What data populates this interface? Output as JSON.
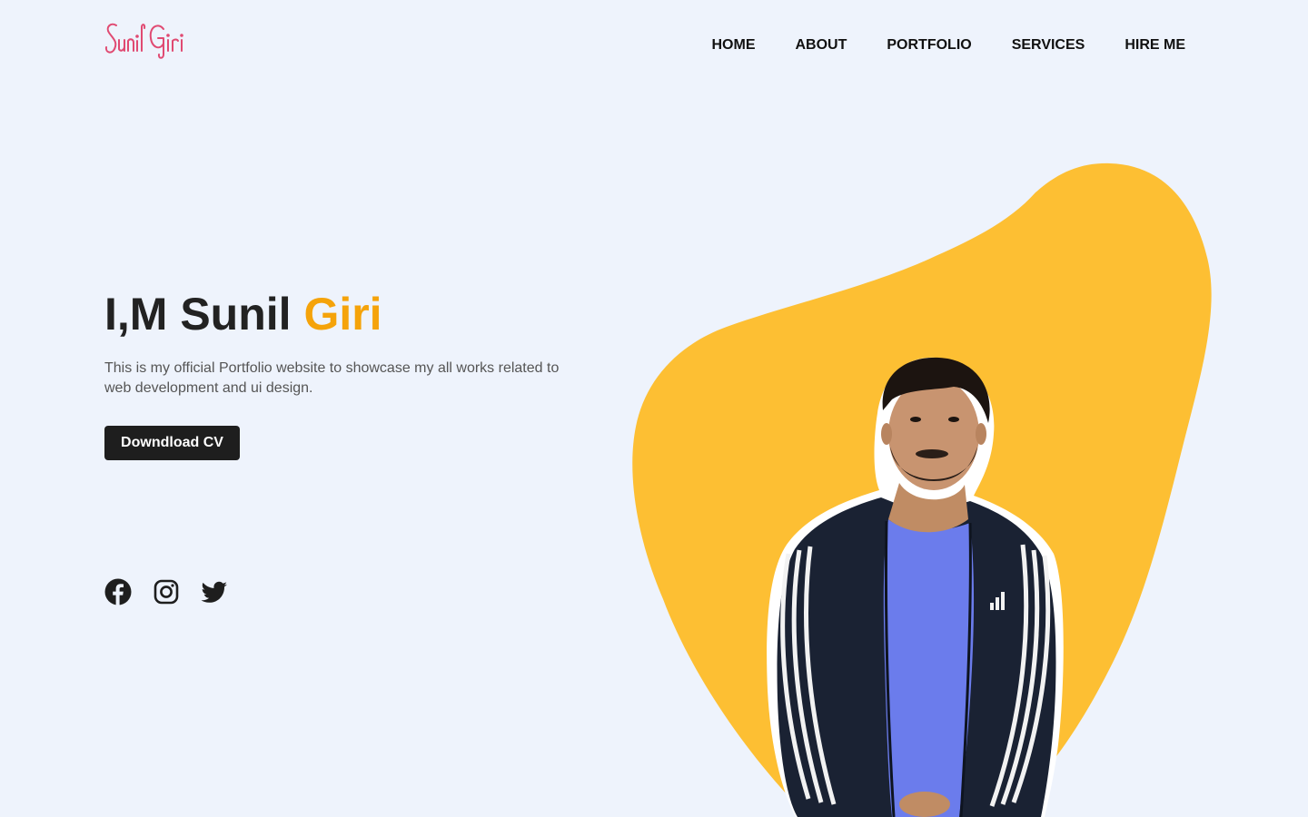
{
  "logo": {
    "text": "Sunil Giri",
    "color": "#e04a72"
  },
  "nav": {
    "items": [
      {
        "label": "HOME"
      },
      {
        "label": "ABOUT"
      },
      {
        "label": "PORTFOLIO"
      },
      {
        "label": "SERVICES"
      },
      {
        "label": "HIRE ME"
      }
    ]
  },
  "hero": {
    "title_prefix": "I,M Sunil ",
    "title_accent": "Giri",
    "description": "This is my official Portfolio website to showcase my all works related to web development and ui design.",
    "cta_label": "Downdload CV"
  },
  "socials": [
    {
      "icon": "facebook-icon"
    },
    {
      "icon": "instagram-icon"
    },
    {
      "icon": "twitter-icon"
    }
  ],
  "colors": {
    "background": "#eef3fc",
    "accent": "#f5a30a",
    "blob": "#fdbf33",
    "button": "#1e1e1e"
  }
}
